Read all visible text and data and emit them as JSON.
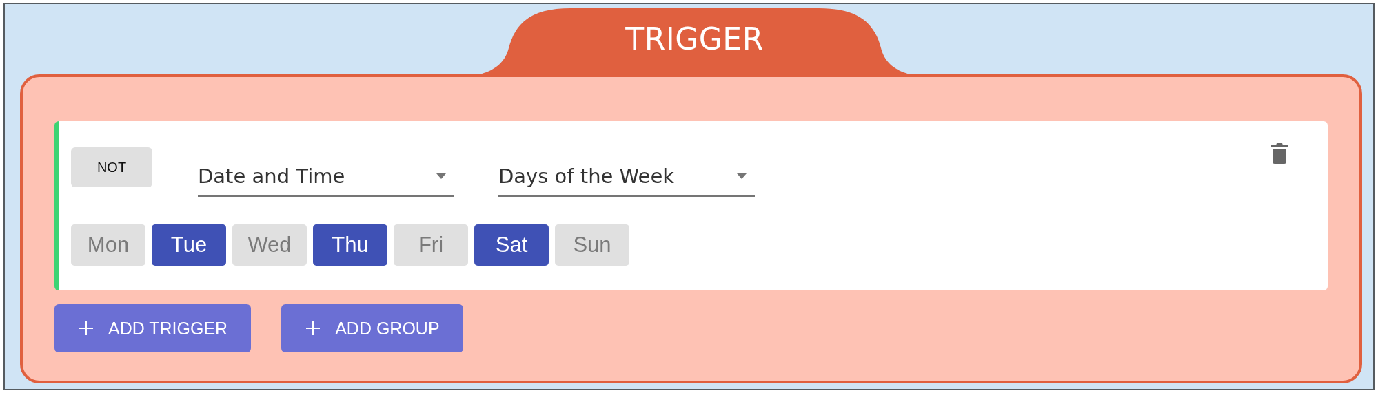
{
  "header": {
    "title": "TRIGGER"
  },
  "condition": {
    "not_label": "NOT",
    "dropdowns": [
      {
        "value": "Date and Time"
      },
      {
        "value": "Days of the Week"
      }
    ],
    "days": [
      {
        "label": "Mon",
        "selected": false
      },
      {
        "label": "Tue",
        "selected": true
      },
      {
        "label": "Wed",
        "selected": false
      },
      {
        "label": "Thu",
        "selected": true
      },
      {
        "label": "Fri",
        "selected": false
      },
      {
        "label": "Sat",
        "selected": true
      },
      {
        "label": "Sun",
        "selected": false
      }
    ]
  },
  "actions": [
    {
      "label": "ADD TRIGGER"
    },
    {
      "label": "ADD GROUP"
    }
  ]
}
